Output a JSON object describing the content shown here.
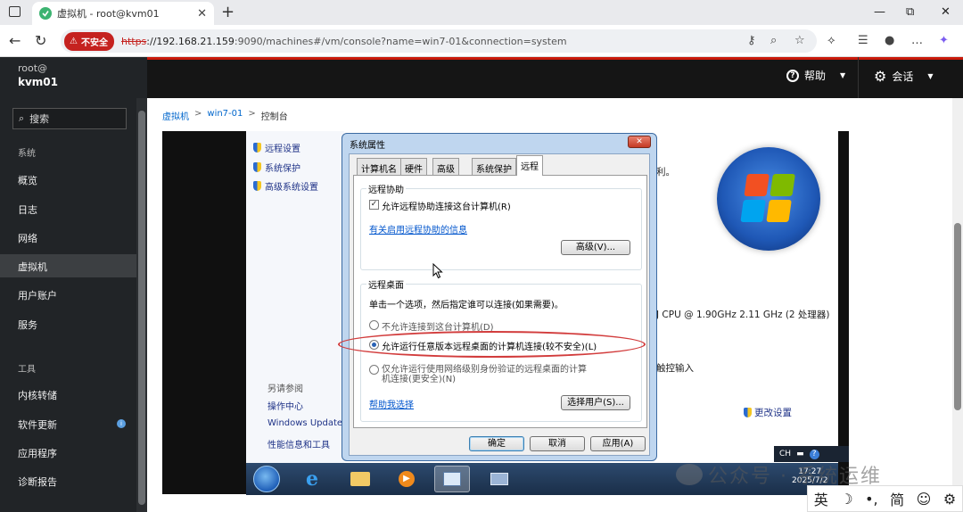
{
  "browser": {
    "tab_title": "虚拟机 - root@kvm01",
    "tab_close": "✕",
    "new_tab": "+",
    "insecure_label": "不安全",
    "url_scheme": "https",
    "url_host": "://192.168.21.159",
    "url_rest": ":9090/machines#/vm/console?name=win7-01&connection=system",
    "win_min": "—",
    "win_max": "⧉",
    "win_close": "✕"
  },
  "cockpit": {
    "user": "root@",
    "host": "kvm01",
    "help": "帮助",
    "session": "会话",
    "search_placeholder": "搜索",
    "nav": {
      "section_system": "系统",
      "overview": "概览",
      "logs": "日志",
      "network": "网络",
      "vms": "虚拟机",
      "accounts": "用户账户",
      "services": "服务",
      "section_tools": "工具",
      "kdump": "内核转储",
      "updates": "软件更新",
      "updates_badge": "i",
      "apps": "应用程序",
      "diagnostics": "诊断报告"
    },
    "breadcrumb": {
      "vms": "虚拟机",
      "vm": "win7-01",
      "console": "控制台",
      "sep": ">"
    }
  },
  "guest": {
    "cp_links": [
      "远程设置",
      "系统保护",
      "高级系统设置"
    ],
    "see_also": "另请参阅",
    "see_links": [
      "操作中心",
      "Windows Update",
      "性能信息和工具"
    ],
    "right_texts": {
      "rights": "利。",
      "cpu": "J CPU @ 1.90GHz   2.11 GHz  (2 处理器)",
      "touch": "触控输入",
      "change_settings": "更改设置"
    },
    "tray_lang": "CH",
    "clock_time": "17:27",
    "clock_date": "2025/7/2"
  },
  "dialog": {
    "title": "系统属性",
    "close": "✕",
    "tabs": [
      "计算机名",
      "硬件",
      "高级",
      "系统保护",
      "远程"
    ],
    "assist_group": "远程协助",
    "allow_assist": "允许远程协助连接这台计算机(R)",
    "assist_check": "✓",
    "assist_info_link": "有关启用远程协助的信息",
    "advanced_btn": "高级(V)...",
    "desktop_group": "远程桌面",
    "desktop_desc": "单击一个选项，然后指定谁可以连接(如果需要)。",
    "opt_none": "不允许连接到这台计算机(D)",
    "opt_any": "允许运行任意版本远程桌面的计算机连接(较不安全)(L)",
    "opt_nla_line1": "仅允许运行使用网络级别身份验证的远程桌面的计算",
    "opt_nla_line2": "机连接(更安全)(N)",
    "help_link": "帮助我选择",
    "select_users_btn": "选择用户(S)...",
    "ok_btn": "确定",
    "cancel_btn": "取消",
    "apply_btn": "应用(A)"
  },
  "watermark": "公众号 · 系统运维",
  "ime": {
    "lang": "英",
    "moon": "☽",
    "punct": "•,",
    "simp": "简",
    "emoji": "☺",
    "gear": "⚙"
  },
  "colors": {
    "cockpit_accent": "#c9190b",
    "insecure_red": "#c5221f",
    "annotation_oval": "#d23c3c",
    "dialog_frame": "#bfd6ef"
  }
}
